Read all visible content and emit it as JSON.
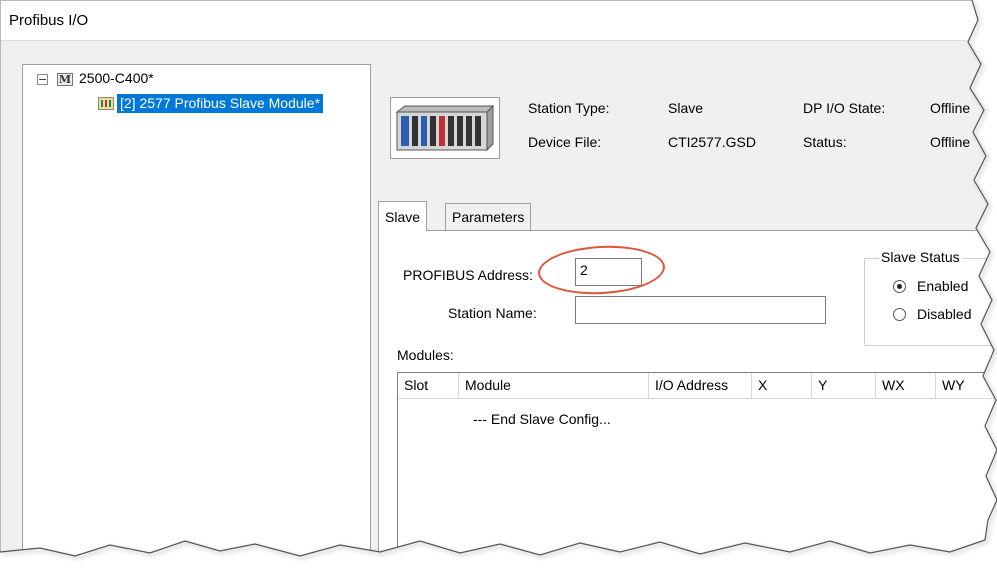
{
  "window": {
    "title": "Profibus I/O"
  },
  "tree": {
    "root": {
      "expander": "−",
      "icon": "M",
      "label": "2500-C400*"
    },
    "child": {
      "label": "[2] 2577 Profibus Slave Module*"
    }
  },
  "station": {
    "type_label": "Station Type:",
    "type_value": "Slave",
    "device_file_label": "Device File:",
    "device_file_value": "CTI2577.GSD",
    "dp_state_label": "DP I/O State:",
    "dp_state_value": "Offline",
    "status_label": "Status:",
    "status_value": "Offline"
  },
  "tabs": [
    {
      "label": "Slave"
    },
    {
      "label": "Parameters"
    }
  ],
  "slave_tab": {
    "address_label": "PROFIBUS Address:",
    "address_value": "2",
    "station_name_label": "Station Name:",
    "station_name_value": "",
    "slave_status": {
      "title": "Slave Status",
      "options": [
        {
          "label": "Enabled",
          "checked": true
        },
        {
          "label": "Disabled",
          "checked": false
        }
      ]
    },
    "modules_label": "Modules:",
    "modules_table": {
      "columns": [
        "Slot",
        "Module",
        "I/O Address",
        "X",
        "Y",
        "WX",
        "WY"
      ],
      "rows": [
        {
          "slot": "",
          "module": "--- End Slave Config..."
        }
      ]
    }
  },
  "colors": {
    "selection": "#0078d7",
    "highlight_circle": "#e0543a"
  }
}
